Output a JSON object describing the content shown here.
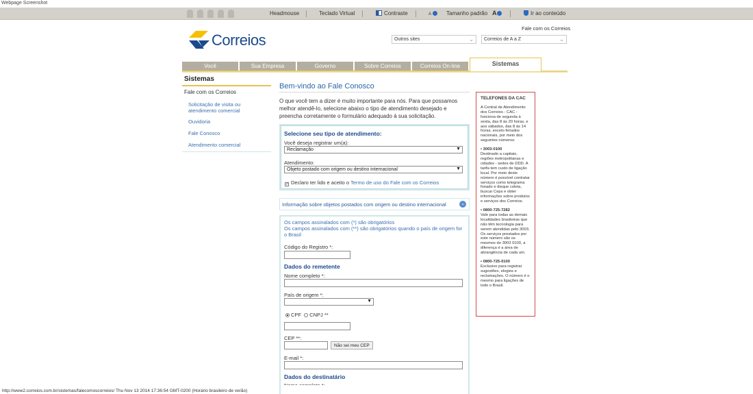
{
  "screenshot_label": "Webpage Screenshot",
  "accessibility": {
    "headmouse": "Headmouse",
    "teclado": "Teclado Virtual",
    "contraste": "Contraste",
    "font_minus": "A",
    "tamanho": "Tamanho padrão",
    "font_plus": "A",
    "ir_conteudo": "Ir ao conteúdo"
  },
  "header": {
    "logo_text": "Correios",
    "fale_link": "Fale com os Correios",
    "outros_sites": "Outros sites",
    "correios_az": "Correios de A a Z"
  },
  "tabs": {
    "items": [
      {
        "label": "Você"
      },
      {
        "label": "Sua Empresa"
      },
      {
        "label": "Governo"
      },
      {
        "label": "Sobre Correios"
      },
      {
        "label": "Correios On-line"
      }
    ],
    "active": "Sistemas"
  },
  "sidebar": {
    "title": "Sistemas",
    "parent": "Fale com os Correios",
    "links": [
      {
        "label": "Solicitação de visita ou atendimento comercial"
      },
      {
        "label": "Ouvidoria"
      },
      {
        "label": "Fale Conosco"
      },
      {
        "label": "Atendimento comercial"
      }
    ]
  },
  "main": {
    "title": "Bem-vindo ao Fale Conosco",
    "intro": "O que você tem a dizer é muito importante para nós. Para que possamos melhor atendê-lo, selecione abaixo o tipo de atendimento desejado e preencha corretamente o formulário adequado à sua solicitação.",
    "selecione": {
      "title": "Selecione seu tipo de atendimento:",
      "registrar_label": "Você deseja registrar um(a):",
      "registrar_value": "Reclamação",
      "atendimento_label": "Atendimento:",
      "atendimento_value": "Objeto postado com origem ou destino internacional",
      "declaro_text": "Declaro ter lido e aceito o ",
      "termo_link": "Termo de uso do Fale com os Correios"
    },
    "accordion_label": "Informação sobre objetos postados com origem ou destino internacional",
    "form": {
      "note1": "Os campos assinalados com (*) são obrigatórios",
      "note2": "Os campos assinalados com (**) são obrigatórios quando o país de origem for o Brasil",
      "codigo_label": "Código do Registro *:",
      "remetente_title": "Dados do remetente",
      "nome_label": "Nome completo *:",
      "pais_label": "País de origem *:",
      "cpf": "CPF",
      "cnpj": "CNPJ **",
      "cep_label": "CEP **:",
      "nao_sei_cep": "Não sei meu CEP",
      "email_label": "E-mail *:",
      "destinatario_title": "Dados do destinatário",
      "nome2_label": "Nome completo *:"
    }
  },
  "info": {
    "title": "TELEFONES DA CAC",
    "intro": "A Central de Atendimento dos Correios - CAC - funciona de segunda à sexta, das 8 às 20 horas, e aos sábados, das 8 às 14 horas, exceto feriados nacionais, por meio dos seguintes números:",
    "items": [
      {
        "num": "• 3003-0100",
        "text": "Destinado a capitais, regiões metropolitanas e cidades - sedes de DDD. A tarifa tem custo de ligação local. Por meio deste número é possível contratar serviços como telegrama fonado e disque coleta, buscar Ceps e obter informações sobre produtos e serviços dos Correios."
      },
      {
        "num": "• 0800-725-7282",
        "text": "Vale para todas as demais localidades brasileiras que não têm tecnologia para serem atendidas pelo 3003. Os serviços prestados por este número são os mesmos do 3003 0100, a diferença é a área de abrangência de cada um."
      },
      {
        "num": "• 0800-725-0100",
        "text": "Exclusivo para registrar sugestões, elogios e reclamações. O número é o mesmo para ligações de todo o Brasil."
      }
    ]
  },
  "footer": "http://www2.correios.com.br/sistemas/falecomoscorreios/ Thu Nov 13 2014 17:36:54 GMT-0200 (Horário brasileiro de verão)",
  "colors": {
    "brand_blue": "#1c4a8a",
    "brand_yellow": "#f5c000",
    "tab_gray": "#b3ae9f",
    "info_border": "#d34a4a"
  }
}
